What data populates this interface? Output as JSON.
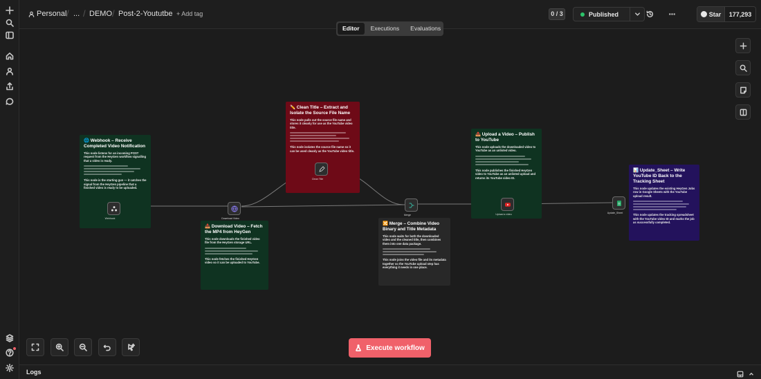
{
  "header": {
    "project": "Personal",
    "ellipsis": "...",
    "folder": "DEMO",
    "workflow_name": "Post-2-Yoututbe",
    "add_tag": "+ Add tag",
    "counter": "0 / 3",
    "status": "Published",
    "github_star": "Star",
    "github_count": "177,293"
  },
  "tabs": [
    "Editor",
    "Executions",
    "Evaluations"
  ],
  "execute_button": "Execute workflow",
  "logs_label": "Logs",
  "notes": {
    "webhook": {
      "title": "🌐 Webhook – Receive Completed Video Notification",
      "subtitle": "This node listens for an incoming POST request from the HeyGen workflow signalling that a video is ready.",
      "footer": "This node is the starting gun — it catches the signal from the HeyGen pipeline that a finished video is ready to be uploaded."
    },
    "download": {
      "title": "📥 Download Video – Fetch the MP4 from HeyGen",
      "subtitle": "This node downloads the finished video file from the HeyGen storage URL.",
      "footer": "This node fetches the finished HeyGen video so it can be uploaded to YouTube."
    },
    "clean": {
      "title": "✏️ Clean Title – Extract and Isolate the Source File Name",
      "subtitle": "This node pulls out the source file name and stores it cleanly for use as the YouTube video title.",
      "footer": "This node isolates the source file name so it can be used cleanly as the YouTube video title."
    },
    "merge": {
      "title": "🔀 Merge – Combine Video Binary and Title Metadata",
      "subtitle": "This node waits for both the downloaded video and the cleaned title, then combines them into one data package.",
      "footer": "This node joins the video file and its metadata together so the YouTube upload step has everything it needs in one place."
    },
    "upload": {
      "title": "📤 Upload a Video – Publish to YouTube",
      "subtitle": "This node uploads the downloaded video to YouTube as an unlisted video.",
      "footer": "This node publishes the finished HeyGen video to YouTube as an unlisted upload and returns its YouTube video ID."
    },
    "update": {
      "title": "📊 Update_Sheet – Write YouTube ID Back to the Tracking Sheet",
      "subtitle": "This node updates the existing HeyGen Jobs row in Google Sheets with the YouTube upload result.",
      "footer": "This node updates the tracking spreadsheet with the YouTube video ID and marks the job as successfully completed."
    }
  },
  "nodes": {
    "webhook": "Webhook",
    "download": "Download Video",
    "clean": "Clean Title",
    "merge": "Merge",
    "upload": "Upload a video",
    "update": "Update_Sheet"
  },
  "colors": {
    "accent": "#f0616a",
    "published": "#2cc46a",
    "note_green": "#0f3321",
    "note_red": "#6e0a17",
    "note_purple": "#23125c"
  }
}
